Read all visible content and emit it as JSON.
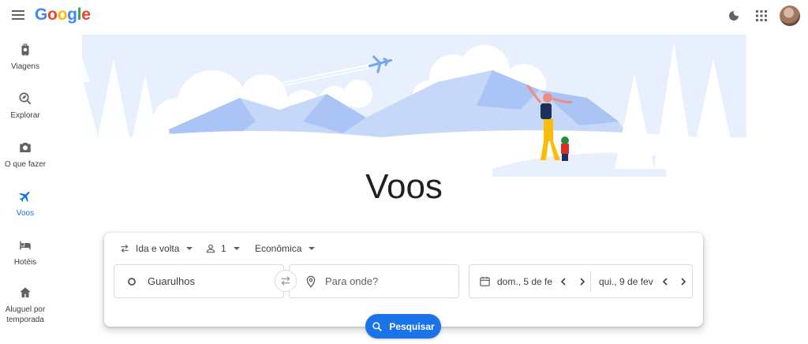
{
  "header": {
    "logo_text": "Google",
    "icons": [
      "menu-icon",
      "dark-mode-icon",
      "apps-grid-icon",
      "avatar"
    ]
  },
  "sidebar": {
    "items": [
      {
        "label": "Viagens",
        "icon": "luggage-icon",
        "active": false
      },
      {
        "label": "Explorar",
        "icon": "explore-icon",
        "active": false
      },
      {
        "label": "O que fazer",
        "icon": "camera-icon",
        "active": false
      },
      {
        "label": "Voos",
        "icon": "flight-icon",
        "active": true
      },
      {
        "label": "Hotéis",
        "icon": "hotel-bed-icon",
        "active": false
      },
      {
        "label": "Aluguel por temporada",
        "icon": "home-icon",
        "active": false
      }
    ]
  },
  "page_title": "Voos",
  "search": {
    "trip_type": "Ida e volta",
    "passengers": "1",
    "cabin_class": "Econômica",
    "origin_value": "Guarulhos",
    "destination_placeholder": "Para onde?",
    "departure_date": "dom., 5 de fe",
    "return_date": "qui., 9 de fev",
    "search_button_label": "Pesquisar"
  },
  "colors": {
    "accent": "#1a73e8",
    "hero_light_blue": "#c6d8f7",
    "hero_mid_blue": "#a9c4f5",
    "text_primary": "#202124",
    "text_secondary": "#5f6368"
  }
}
